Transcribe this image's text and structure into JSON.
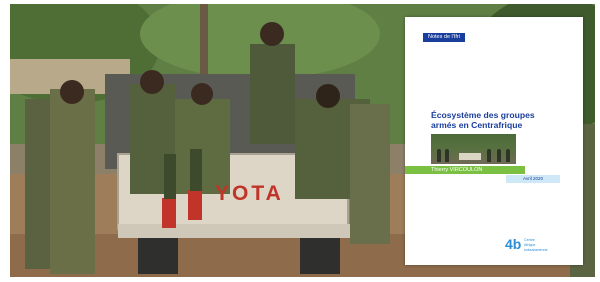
{
  "truck": {
    "brand_text": "YOTA"
  },
  "cover": {
    "series_label": "Notes de l'Ifri",
    "title_lines": [
      "Écosystème des groupes",
      "armés en Centrafrique"
    ],
    "author": "Thierry VIRCOULON",
    "date": "Avril 2020",
    "logo": {
      "mark": "4b",
      "lines": [
        "Centre",
        "Afrique",
        "subsaharienne"
      ]
    }
  },
  "colors": {
    "ifri_blue": "#1a3e9c",
    "author_green": "#7bc043",
    "date_blue": "#cfe8f7",
    "truck_red": "#c0342a"
  }
}
